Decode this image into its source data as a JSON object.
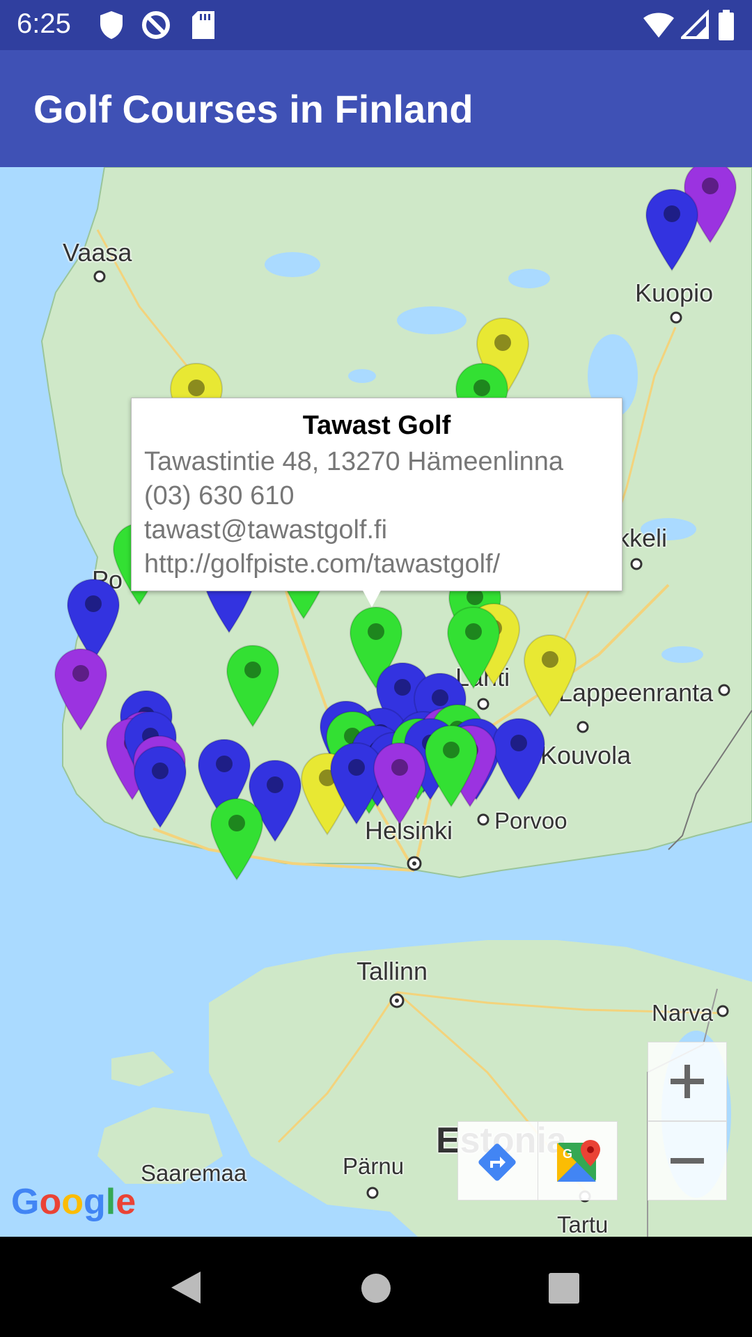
{
  "status_bar": {
    "time": "6:25",
    "icons": [
      "shield-icon",
      "data-saver-icon",
      "sd-card-icon",
      "wifi-icon",
      "signal-icon",
      "battery-icon"
    ]
  },
  "app_bar": {
    "title": "Golf Courses in Finland",
    "color": "#3f51b5"
  },
  "map": {
    "places": [
      {
        "name": "Vaasa"
      },
      {
        "name": "Kuopio"
      },
      {
        "name": "Mikkeli",
        "shown": "ikkeli"
      },
      {
        "name": "Po"
      },
      {
        "name": "Lahti",
        "shown": "Lahti"
      },
      {
        "name": "Lappeenranta"
      },
      {
        "name": "Kouvola"
      },
      {
        "name": "Porvoo"
      },
      {
        "name": "Helsinki"
      },
      {
        "name": "Tallinn"
      },
      {
        "name": "Narva"
      },
      {
        "name": "Estonia"
      },
      {
        "name": "Saaremaa"
      },
      {
        "name": "Pärnu"
      },
      {
        "name": "Tartu"
      }
    ],
    "marker_colors": {
      "green": "#33e033",
      "blue": "#3333e0",
      "purple": "#9b33e0",
      "yellow": "#e8e833"
    },
    "info_window": {
      "title": "Tawast Golf",
      "address": "Tawastintie 48, 13270 Hämeenlinna",
      "phone": "(03) 630 610",
      "email": "tawast@tawastgolf.fi",
      "url": "http://golfpiste.com/tawastgolf/"
    },
    "controls": {
      "zoom_in": "+",
      "zoom_out": "−"
    },
    "attribution": "Google"
  },
  "nav_bar": {
    "buttons": [
      "back-icon",
      "home-icon",
      "recents-icon"
    ]
  }
}
